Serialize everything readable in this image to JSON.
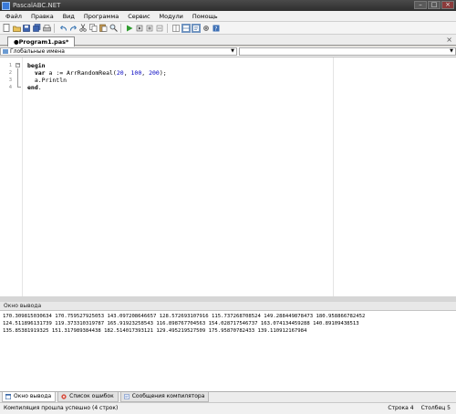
{
  "window": {
    "title": "PascalABC.NET"
  },
  "menu": [
    "Файл",
    "Правка",
    "Вид",
    "Программа",
    "Сервис",
    "Модули",
    "Помощь"
  ],
  "toolbar": {
    "buttons": [
      "new-file-icon",
      "open-icon",
      "save-icon",
      "save-all-icon",
      "print-icon",
      "undo-icon",
      "redo-icon",
      "cut-icon",
      "copy-icon",
      "paste-icon",
      "find-icon",
      "replace-icon",
      "run-icon",
      "step-icon",
      "stop-icon",
      "debug-icon",
      "split-vertical-icon",
      "split-horizontal-icon",
      "settings-icon",
      "output-icon",
      "help-icon"
    ]
  },
  "tab": {
    "label": "●Program1.pas*"
  },
  "combos": {
    "left_value": "Глобальные имена",
    "right_value": ""
  },
  "editor": {
    "line_numbers": [
      "1",
      "2",
      "3",
      "4"
    ],
    "lines": [
      {
        "keyword": "begin",
        "rest": ""
      },
      {
        "keyword": "  var",
        "rest": " a := ArrRandomReal(",
        "n1": "20",
        "c1": ", ",
        "n2": "100",
        "c2": ", ",
        "n3": "200",
        "tail": ");"
      },
      {
        "keyword": "",
        "rest": "  a.Println"
      },
      {
        "keyword": "end",
        "rest": "."
      }
    ]
  },
  "output": {
    "header": "Окно вывода",
    "lines": [
      "170.309815030634 170.759527925053 143.097208646657 128.572693107916 115.737268708524 149.288449878473 180.958866782452",
      "124.511896131739 119.373310319787 165.91923258543 116.898767704563 154.028717546737 163.074134459288 140.89109438513",
      "135.85381919325 151.317989384438 182.514017393121 129.495219527509 175.95870782433 139.110912167984"
    ]
  },
  "bottom_tabs": [
    "Окно вывода",
    "Список ошибок",
    "Сообщения компилятора"
  ],
  "status": {
    "message": "Компиляция прошла успешно (4 строк)",
    "row_label": "Строка",
    "row": "4",
    "col_label": "Столбец",
    "col": "5"
  }
}
